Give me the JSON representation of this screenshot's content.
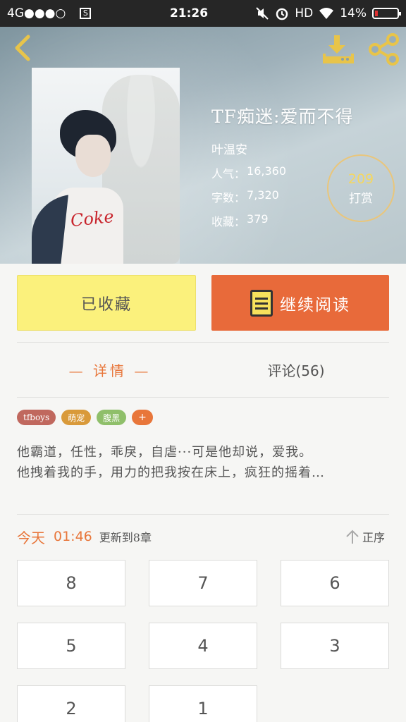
{
  "status_bar": {
    "network": "4G●●●○",
    "s_icon": "S",
    "time": "21:26",
    "hd": "HD",
    "battery": "14%"
  },
  "header": {
    "icons": [
      "back-arrow-icon",
      "download-icon",
      "share-icon"
    ],
    "colors": {
      "icon": "#e8c44a",
      "reward_ring": "#e9c67c",
      "reward_value": "#f5d75f"
    }
  },
  "book": {
    "title": "TF痴迷:爱而不得",
    "author": "叶温安",
    "popularity_label": "人气：",
    "popularity": "16,360",
    "words_label": "字数：",
    "words": "7,320",
    "favorites_label": "收藏：",
    "favorites": "379",
    "cover_text": "Coke"
  },
  "reward": {
    "count": "209",
    "label": "打赏"
  },
  "actions": {
    "collected_label": "已收藏",
    "continue_label": "继续阅读",
    "colors": {
      "collected": "#fbf17c",
      "continue": "#e86a3a"
    }
  },
  "tabs": {
    "details": "— 详情 —",
    "comments": "评论(56)",
    "accent": "#e8763a"
  },
  "tags": [
    {
      "label": "tfboys",
      "color": "#c0685e"
    },
    {
      "label": "萌宠",
      "color": "#d99a3a"
    },
    {
      "label": "腹黑",
      "color": "#8fbf6a"
    },
    {
      "label": "+",
      "color": "#e8763a"
    }
  ],
  "description": {
    "line1": "他霸道，任性，乖戾，自虐···可是他却说，爱我。",
    "line2": "他拽着我的手，用力的把我按在床上，疯狂的摇着…"
  },
  "update": {
    "today": "今天",
    "time": "01:46",
    "text": "更新到8章",
    "sort_label": "正序"
  },
  "chapters": [
    "8",
    "7",
    "6",
    "5",
    "4",
    "3",
    "2",
    "1"
  ]
}
